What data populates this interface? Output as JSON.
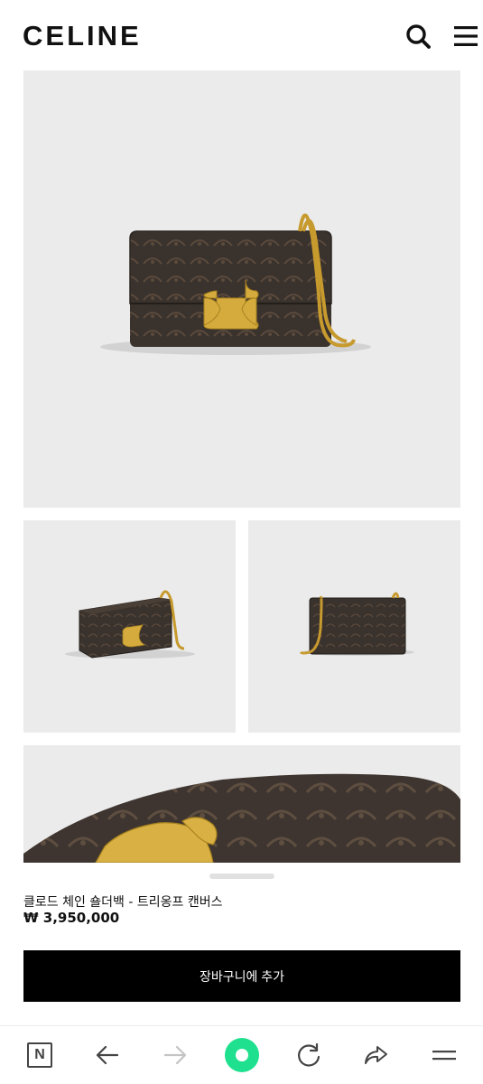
{
  "header": {
    "logo": "CELINE",
    "icons": [
      "search-icon",
      "hamburger-menu-icon"
    ]
  },
  "gallery": {
    "images": [
      "product-image-front",
      "product-image-side",
      "product-image-back",
      "product-image-detail"
    ]
  },
  "product": {
    "name": "클로드 체인 숄더백 - 트리옹프 캔버스",
    "price": "₩ 3,950,000",
    "add_to_cart_label": "장바구니에 추가"
  },
  "browser_bar": {
    "tab_label": "N",
    "icons": [
      "naver-tab-icon",
      "back-arrow-icon",
      "forward-arrow-icon",
      "green-dot-home-icon",
      "reload-icon",
      "share-icon",
      "menu-icon"
    ]
  },
  "colors": {
    "brand_text": "#111111",
    "image_bg": "#ebebeb",
    "bag_brown": "#3b3430",
    "gold": "#c9a23a",
    "button_bg": "#000000",
    "home_green": "#1ee08e"
  }
}
